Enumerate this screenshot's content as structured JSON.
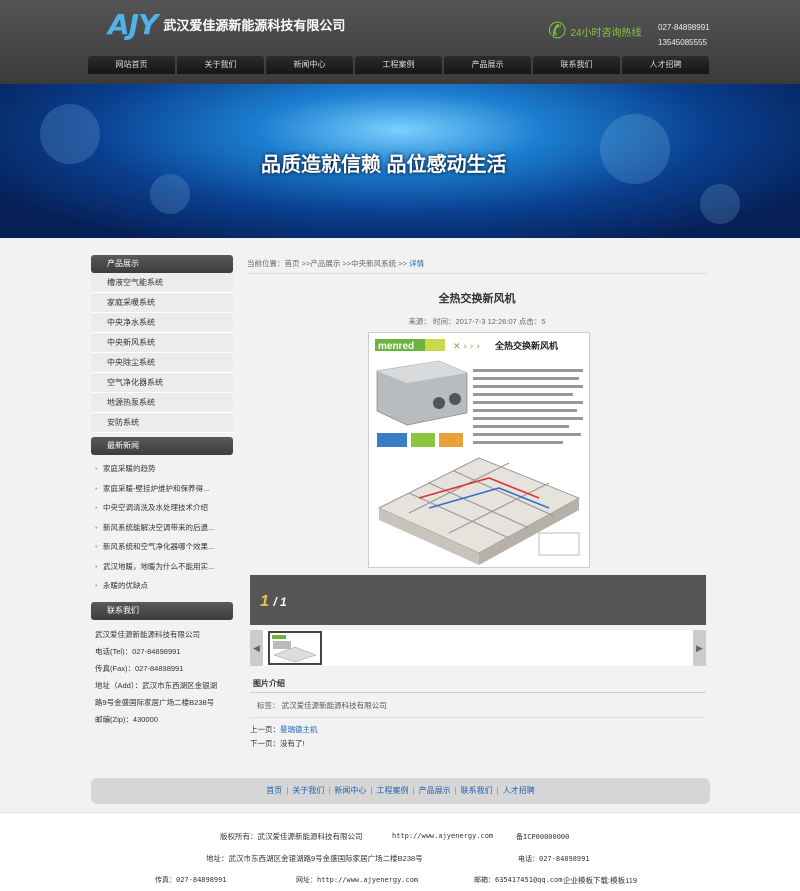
{
  "header": {
    "logo_mark": "AJY",
    "company": "武汉爱佳源新能源科技有限公司",
    "hotline": "24小时咨询热线",
    "phone1": "027-84898991",
    "phone2": "13545085555"
  },
  "nav": [
    "网站首页",
    "关于我们",
    "新闻中心",
    "工程案例",
    "产品展示",
    "联系我们",
    "人才招聘"
  ],
  "banner": {
    "slogan": "品质造就信赖 品位感动生活"
  },
  "sidebar": {
    "products_title": "产品展示",
    "products": [
      "槽液空气能系统",
      "家庭采暖系统",
      "中央净水系统",
      "中央新风系统",
      "中央除尘系统",
      "空气净化器系统",
      "地源热泵系统",
      "安防系统"
    ],
    "news_title": "最新新闻",
    "news": [
      "家庭采暖的趋势",
      "家庭采暖-壁挂炉维护和保养得...",
      "中央空调清洗及水处理技术介绍",
      "新风系统能解决空调带来的后遗...",
      "新风系统和空气净化器哪个效果...",
      "武汉地暖，地暖为什么不能用实...",
      "永暖的优缺点"
    ],
    "contact_title": "联系我们",
    "contact": {
      "company": "武汉爱佳源新能源科技有限公司",
      "tel": "电话(Tel)：027-84898991",
      "fax": "传真(Fax)：027-84898991",
      "addr1": "地址（Add）：武汉市东西湖区金银湖",
      "addr2": "路9号金盛国际家居广场二楼B238号",
      "zip": "邮编(Zip)：430000"
    }
  },
  "main": {
    "crumb": "当前位置：首页 >>产品展示 >>中央新风系统 >>",
    "crumb_current": "详情",
    "title": "全热交换新风机",
    "meta": "来源：  时间：2017-7-3 12:26:07 点击：5",
    "photo_brand": "menred",
    "photo_title": "全热交换新风机",
    "page_current": "1",
    "page_total": "/ 1",
    "intro_title": "图片介绍",
    "tags": "标签：  武汉爱佳源新能源科技有限公司",
    "prev_label": "上一页：",
    "prev_link": "曼瑞德主机",
    "next_label": "下一页：没有了!"
  },
  "footer_nav": [
    "首页",
    "关于我们",
    "新闻中心",
    "工程案例",
    "产品展示",
    "联系我们",
    "人才招聘"
  ],
  "footer": {
    "copyright": "版权所有：武汉爱佳源新能源科技有限公司",
    "url": "http://www.ajyenergy.com",
    "icp": "备ICP00000000",
    "address": "地址：武汉市东西湖区金银湖路9号金盛国际家居广场二楼B238号",
    "tel": "电话：027-84898991",
    "fax": "传真：027-84898991",
    "web": "网址：http://www.ajyenergy.com",
    "email": "邮箱：635417451@qq.com",
    "tpl": "企业模板下载:模板119"
  }
}
